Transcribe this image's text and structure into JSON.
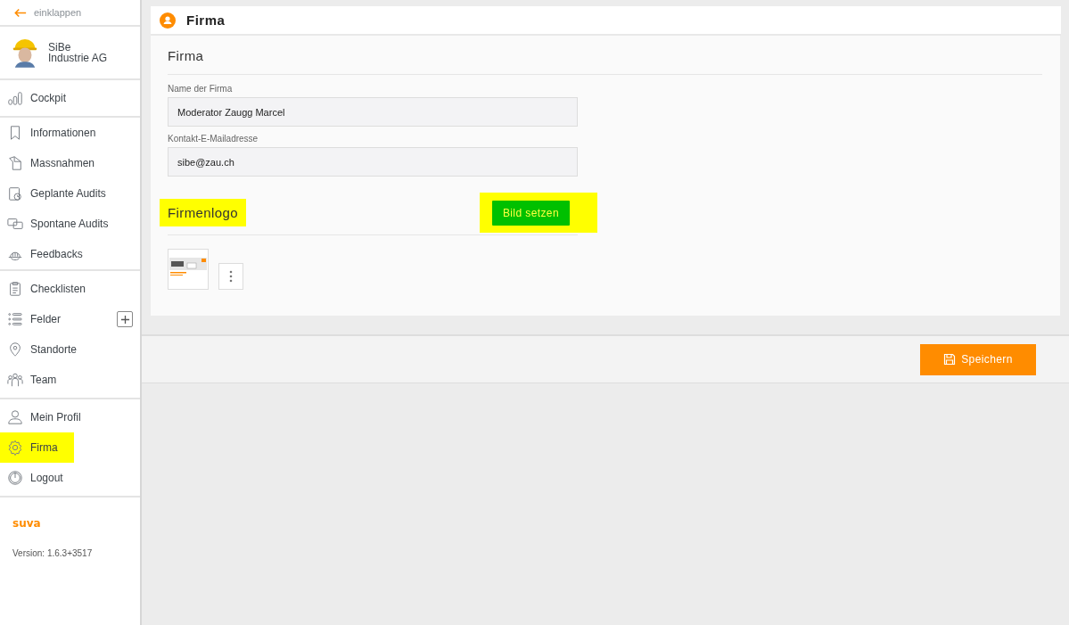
{
  "sidebar": {
    "collapse_label": "einklappen",
    "profile": {
      "line_1": "SiBe",
      "line_2": "Industrie AG"
    },
    "groups": [
      [
        {
          "label": "Cockpit",
          "highlighted": false
        }
      ],
      [
        {
          "label": "Informationen",
          "highlighted": false
        },
        {
          "label": "Massnahmen",
          "highlighted": false
        },
        {
          "label": "Geplante Audits",
          "highlighted": false
        },
        {
          "label": "Spontane Audits",
          "highlighted": false
        },
        {
          "label": "Feedbacks",
          "highlighted": false
        }
      ],
      [
        {
          "label": "Checklisten",
          "highlighted": false
        },
        {
          "label": "Felder",
          "highlighted": false,
          "has_add": true
        },
        {
          "label": "Standorte",
          "highlighted": false
        },
        {
          "label": "Team",
          "highlighted": false
        }
      ],
      [
        {
          "label": "Mein Profil",
          "highlighted": false
        },
        {
          "label": "Firma",
          "highlighted": true
        },
        {
          "label": "Logout",
          "highlighted": false
        }
      ]
    ],
    "brand": "suva",
    "version": "Version: 1.6.3+3517"
  },
  "page": {
    "title": "Firma",
    "section_title": "Firma",
    "fields": [
      {
        "label": "Name der Firma",
        "value": "Moderator Zaugg Marcel"
      },
      {
        "label": "Kontakt-E-Mailadresse",
        "value": "sibe@zau.ch"
      }
    ],
    "logo_section": {
      "title": "Firmenlogo",
      "highlighted": true,
      "button": {
        "label": "Bild setzen",
        "highlighted": true
      }
    },
    "save_button": "Speichern"
  }
}
